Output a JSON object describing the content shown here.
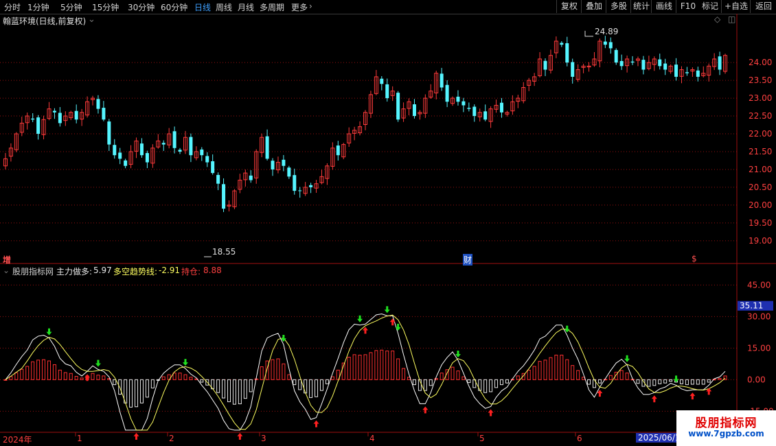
{
  "toolbar": {
    "periods": [
      {
        "label": "分时",
        "active": false
      },
      {
        "label": "1分钟",
        "active": false
      },
      {
        "label": "5分钟",
        "active": false
      },
      {
        "label": "15分钟",
        "active": false
      },
      {
        "label": "30分钟",
        "active": false
      },
      {
        "label": "60分钟",
        "active": false
      },
      {
        "label": "日线",
        "active": true
      },
      {
        "label": "周线",
        "active": false
      },
      {
        "label": "月线",
        "active": false
      },
      {
        "label": "多周期",
        "active": false
      },
      {
        "label": "更多",
        "active": false
      }
    ],
    "right_buttons": [
      "复权",
      "叠加",
      "多股",
      "统计",
      "画线",
      "F10",
      "+自选",
      "返回"
    ]
  },
  "main_header": {
    "title": "翰蓝环境(日线,前复权)"
  },
  "main_axis": {
    "ticks": [
      "24.00",
      "23.50",
      "23.00",
      "22.50",
      "22.00",
      "21.50",
      "21.00",
      "20.50",
      "20.00",
      "19.50",
      "19.00"
    ]
  },
  "annotations": {
    "high": "24.89",
    "low": "18.55",
    "marker_zeng": "增",
    "marker_cai": "财",
    "marker_dollar": "$"
  },
  "indicator_header": {
    "site": "股朋指标网",
    "label1": "主力做多:",
    "value1": "5.97",
    "label2": "多空趋势线:",
    "value2": "-2.91",
    "label3": "持仓:",
    "value3": "8.88"
  },
  "indicator_axis": {
    "ticks": [
      "45.00",
      "30.00",
      "15.00",
      "0.00",
      "-15.00"
    ],
    "current_badge": "35.11"
  },
  "time_axis": {
    "labels": [
      "2024年",
      "1",
      "2",
      "3",
      "4",
      "5",
      "6"
    ],
    "date_badge": "2025/06/19"
  },
  "watermark": {
    "line1": "股朋指标网",
    "line2": "www.7gpzb.com"
  },
  "colors": {
    "up": "#ff3b3b",
    "down": "#55f5ff",
    "grid": "#9a1010",
    "line_white": "#ffffff",
    "line_yellow": "#ffff60",
    "arrow_up": "#ff2020",
    "arrow_down": "#20e020",
    "active_tab": "#3fa0ff"
  },
  "chart_data": [
    {
      "type": "candlestick",
      "title": "翰蓝环境(日线,前复权)",
      "ylim": [
        18.4,
        25.1
      ],
      "max_label": "24.89",
      "min_label": "18.55",
      "closes": [
        21.3,
        21.6,
        22.0,
        22.3,
        22.5,
        22.4,
        22.0,
        22.4,
        22.7,
        22.6,
        22.3,
        22.5,
        22.6,
        22.4,
        22.6,
        22.9,
        23.0,
        22.7,
        22.4,
        21.7,
        21.4,
        21.3,
        21.1,
        21.5,
        21.8,
        21.4,
        21.2,
        21.6,
        21.8,
        21.7,
        22.0,
        21.6,
        21.5,
        21.9,
        21.4,
        21.5,
        21.4,
        21.2,
        20.9,
        20.6,
        19.9,
        20.0,
        20.4,
        20.7,
        20.9,
        20.7,
        21.5,
        21.9,
        21.3,
        21.0,
        21.2,
        21.1,
        20.8,
        20.4,
        20.4,
        20.5,
        20.5,
        20.6,
        20.8,
        21.1,
        21.6,
        21.4,
        21.7,
        22.0,
        22.1,
        22.2,
        22.6,
        23.1,
        23.6,
        23.4,
        23.0,
        23.2,
        22.4,
        22.7,
        22.9,
        22.5,
        22.6,
        23.0,
        23.2,
        23.7,
        23.3,
        22.9,
        23.0,
        22.9,
        22.8,
        22.7,
        22.5,
        22.6,
        22.4,
        22.7,
        22.8,
        22.6,
        22.6,
        22.9,
        23.0,
        23.3,
        23.5,
        23.6,
        24.1,
        23.8,
        24.2,
        24.6,
        24.5,
        24.0,
        23.6,
        23.8,
        23.9,
        23.9,
        24.1,
        24.6,
        24.5,
        24.4,
        24.0,
        23.9,
        24.1,
        24.0,
        24.1,
        23.8,
        24.0,
        24.1,
        23.9,
        23.8,
        23.9,
        23.6,
        23.8,
        23.7,
        23.8,
        23.6,
        23.7,
        23.9,
        24.1,
        23.8,
        24.2
      ],
      "series_meta": {
        "note": "",
        "count": 132
      }
    },
    {
      "type": "bar_line_combo",
      "ylim": [
        -25,
        50
      ],
      "series": [
        {
          "name": "主力做多",
          "kind": "line",
          "value": 5.97
        },
        {
          "name": "多空趋势线",
          "kind": "line",
          "value": -2.91
        },
        {
          "name": "持仓",
          "kind": "bar",
          "value": 8.88
        }
      ],
      "current": 35.11
    }
  ]
}
